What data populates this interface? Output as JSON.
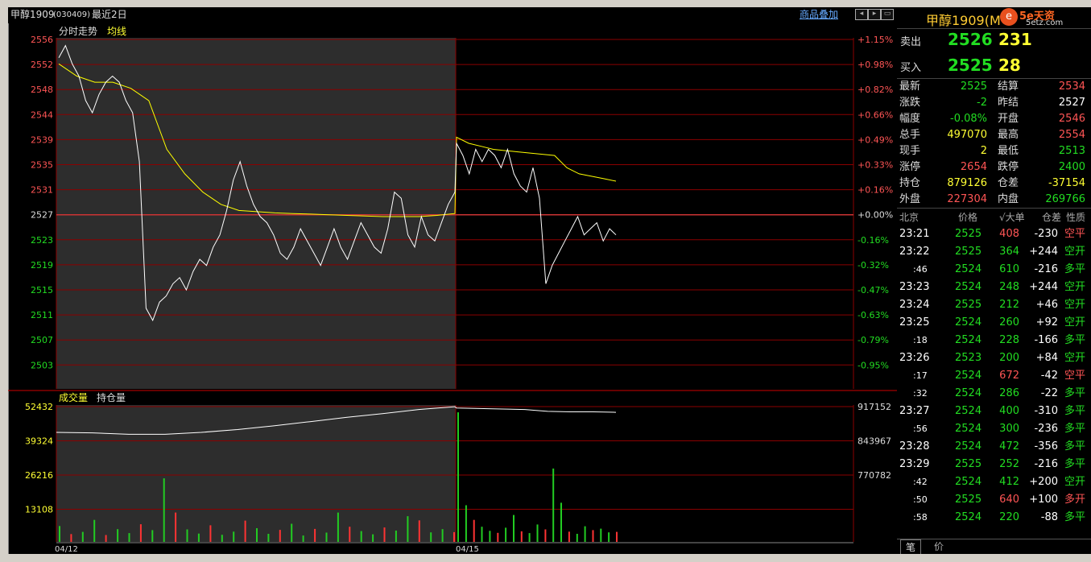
{
  "header": {
    "title": "甲醇1909",
    "code": "(030409)",
    "range": "最近2日",
    "overlay_link": "商品叠加"
  },
  "main_chart": {
    "legend_trend": "分时走势",
    "legend_avg": "均线",
    "price_ticks": [
      "2556",
      "2552",
      "2548",
      "2544",
      "2539",
      "2535",
      "2531",
      "2527",
      "2523",
      "2519",
      "2515",
      "2511",
      "2507",
      "2503"
    ],
    "pct_ticks": [
      "+1.15%",
      "+0.98%",
      "+0.82%",
      "+0.66%",
      "+0.49%",
      "+0.33%",
      "+0.16%",
      "+0.00%",
      "-0.16%",
      "-0.32%",
      "-0.47%",
      "-0.63%",
      "-0.79%",
      "-0.95%"
    ],
    "dates": [
      "04/12",
      "04/15"
    ]
  },
  "volume_chart": {
    "legend_vol": "成交量",
    "legend_oi": "持仓量",
    "vol_ticks": [
      "52432",
      "39324",
      "26216",
      "13108"
    ],
    "oi_ticks": [
      "917152",
      "843967",
      "770782"
    ]
  },
  "chart_data": [
    {
      "type": "line",
      "ylim": [
        2501,
        2558
      ],
      "prev_settle": 2527,
      "series": [
        {
          "name": "分时走势",
          "values": [
            2553,
            2555,
            2552,
            2550,
            2546,
            2544,
            2547,
            2549,
            2550,
            2549,
            2546,
            2544,
            2536,
            2512,
            2510,
            2513,
            2514,
            2516,
            2517,
            2515,
            2518,
            2520,
            2519,
            2522,
            2524,
            2528,
            2533,
            2536,
            2532,
            2529,
            2527,
            2526,
            2524,
            2521,
            2520,
            2522,
            2525,
            2523,
            2521,
            2519,
            2522,
            2525,
            2522,
            2520,
            2523,
            2526,
            2524,
            2522,
            2521,
            2525,
            2531,
            2530,
            2524,
            2522,
            2527,
            2524,
            2523,
            2526,
            2529,
            2531,
            2539,
            2537,
            2534,
            2538,
            2536,
            2538,
            2537,
            2535,
            2538,
            2534,
            2532,
            2531,
            2535,
            2530,
            2516,
            2519,
            2521,
            2523,
            2525,
            2527,
            2524,
            2525,
            2526,
            2523,
            2525,
            2524
          ]
        },
        {
          "name": "均线",
          "values": [
            2552,
            2550,
            2549,
            2549,
            2548,
            2546,
            2538,
            2534,
            2531,
            2529,
            2528,
            2527.8,
            2527.6,
            2527.5,
            2527.4,
            2527.3,
            2527.2,
            2527.1,
            2527,
            2527,
            2527,
            2527.2,
            2527.5,
            2540,
            2539,
            2538.5,
            2538,
            2537.8,
            2537.6,
            2537.4,
            2537.2,
            2537,
            2535,
            2534,
            2533.6,
            2533.2,
            2532.8
          ]
        }
      ]
    },
    {
      "type": "bar",
      "ylim": [
        0,
        56000
      ],
      "series": [
        {
          "name": "成交量",
          "values": [
            6500,
            3200,
            4100,
            9000,
            2800,
            5200,
            3600,
            7200,
            4800,
            26000,
            12000,
            5100,
            3400,
            6800,
            2900,
            4200,
            8700,
            5600,
            3300,
            4900,
            7400,
            2600,
            5300,
            3800,
            12000,
            6200,
            4400,
            3100,
            5900,
            4600,
            10500,
            8800,
            3900,
            5200,
            4000,
            53000,
            15000,
            9000,
            6200,
            4500,
            3700,
            5800,
            11000,
            4300,
            3600,
            7100,
            5100,
            30000,
            16000,
            4200,
            3300,
            6400,
            4800,
            5400,
            3900,
            4100
          ]
        },
        {
          "name": "持仓量",
          "values": [
            862000,
            861000,
            858000,
            858000,
            862000,
            868000,
            876000,
            885000,
            894000,
            902000,
            911000,
            917000,
            914000,
            913000,
            912000,
            911000,
            907000,
            906000,
            906000,
            905000
          ]
        }
      ]
    }
  ],
  "right_panel": {
    "title": "甲醇1909(M",
    "logo_text": "5e天资",
    "logo_url": "5etz.com",
    "sell_label": "卖出",
    "sell_price": "2526",
    "sell_vol": "231",
    "buy_label": "买入",
    "buy_price": "2525",
    "buy_vol": "28",
    "quotes": [
      {
        "l1": "最新",
        "v1": "2525",
        "c1": "green",
        "l2": "结算",
        "v2": "2534",
        "c2": "red"
      },
      {
        "l1": "涨跌",
        "v1": "-2",
        "c1": "green",
        "l2": "昨结",
        "v2": "2527",
        "c2": "white"
      },
      {
        "l1": "幅度",
        "v1": "-0.08%",
        "c1": "green",
        "l2": "开盘",
        "v2": "2546",
        "c2": "red"
      },
      {
        "l1": "总手",
        "v1": "497070",
        "c1": "yellow",
        "l2": "最高",
        "v2": "2554",
        "c2": "red"
      },
      {
        "l1": "现手",
        "v1": "2",
        "c1": "yellow",
        "l2": "最低",
        "v2": "2513",
        "c2": "green"
      },
      {
        "l1": "涨停",
        "v1": "2654",
        "c1": "red",
        "l2": "跌停",
        "v2": "2400",
        "c2": "green"
      },
      {
        "l1": "持仓",
        "v1": "879126",
        "c1": "yellow",
        "l2": "仓差",
        "v2": "-37154",
        "c2": "yellow"
      },
      {
        "l1": "外盘",
        "v1": "227304",
        "c1": "red",
        "l2": "内盘",
        "v2": "269766",
        "c2": "green"
      }
    ],
    "ticks_header": [
      "北京",
      "价格",
      "√大单",
      "仓差",
      "性质"
    ],
    "ticks": [
      {
        "time": "23:21",
        "price": "2525",
        "vol": "408",
        "vc": "red",
        "diff": "-230",
        "nature": "空平",
        "nc": "red"
      },
      {
        "time": "23:22",
        "price": "2525",
        "vol": "364",
        "vc": "green",
        "diff": "+244",
        "nature": "空开",
        "nc": "green"
      },
      {
        "time": ":46",
        "price": "2524",
        "vol": "610",
        "vc": "green",
        "diff": "-216",
        "nature": "多平",
        "nc": "green"
      },
      {
        "time": "23:23",
        "price": "2524",
        "vol": "248",
        "vc": "green",
        "diff": "+244",
        "nature": "空开",
        "nc": "green"
      },
      {
        "time": "23:24",
        "price": "2525",
        "vol": "212",
        "vc": "green",
        "diff": "+46",
        "nature": "空开",
        "nc": "green"
      },
      {
        "time": "23:25",
        "price": "2524",
        "vol": "260",
        "vc": "green",
        "diff": "+92",
        "nature": "空开",
        "nc": "green"
      },
      {
        "time": ":18",
        "price": "2524",
        "vol": "228",
        "vc": "green",
        "diff": "-166",
        "nature": "多平",
        "nc": "green"
      },
      {
        "time": "23:26",
        "price": "2523",
        "vol": "200",
        "vc": "green",
        "diff": "+84",
        "nature": "空开",
        "nc": "green"
      },
      {
        "time": ":17",
        "price": "2524",
        "vol": "672",
        "vc": "red",
        "diff": "-42",
        "nature": "空平",
        "nc": "red"
      },
      {
        "time": ":32",
        "price": "2524",
        "vol": "286",
        "vc": "green",
        "diff": "-22",
        "nature": "多平",
        "nc": "green"
      },
      {
        "time": "23:27",
        "price": "2524",
        "vol": "400",
        "vc": "green",
        "diff": "-310",
        "nature": "多平",
        "nc": "green"
      },
      {
        "time": ":56",
        "price": "2524",
        "vol": "300",
        "vc": "green",
        "diff": "-236",
        "nature": "多平",
        "nc": "green"
      },
      {
        "time": "23:28",
        "price": "2524",
        "vol": "472",
        "vc": "green",
        "diff": "-356",
        "nature": "多平",
        "nc": "green"
      },
      {
        "time": "23:29",
        "price": "2525",
        "vol": "252",
        "vc": "green",
        "diff": "-216",
        "nature": "多平",
        "nc": "green"
      },
      {
        "time": ":42",
        "price": "2524",
        "vol": "412",
        "vc": "green",
        "diff": "+200",
        "nature": "空开",
        "nc": "green"
      },
      {
        "time": ":50",
        "price": "2525",
        "vol": "640",
        "vc": "red",
        "diff": "+100",
        "nature": "多开",
        "nc": "red"
      },
      {
        "time": ":58",
        "price": "2524",
        "vol": "220",
        "vc": "green",
        "diff": "-88",
        "nature": "多平",
        "nc": "green"
      }
    ],
    "tab_ticks": "笔",
    "tab_price": "价"
  },
  "colors": {
    "grid": "#8b0000",
    "price": "#ffffff",
    "avg": "#ffff00",
    "up": "#ff3333",
    "down": "#22cc22"
  }
}
